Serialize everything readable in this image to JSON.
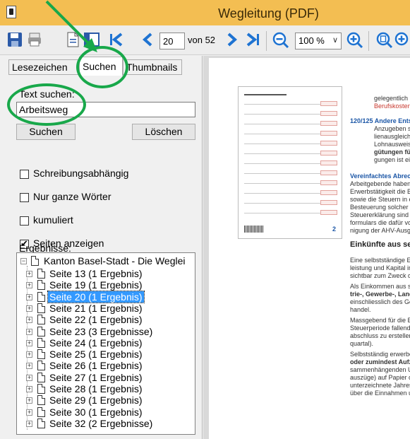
{
  "window": {
    "title": "Wegleitung (PDF)"
  },
  "toolbar": {
    "page_value": "20",
    "page_total_label": "von 52",
    "zoom_value": "100 %",
    "icons": [
      "save-icon",
      "print-icon",
      "document-icon",
      "sidebar-icon",
      "first-page-icon",
      "previous-page-icon",
      "next-page-icon",
      "last-page-icon",
      "zoom-out-icon",
      "zoom-in-icon",
      "zoom-page-icon",
      "zoom-width-icon"
    ]
  },
  "tabs": [
    {
      "label": "Lesezeichen"
    },
    {
      "label": "Suchen"
    },
    {
      "label": "Thumbnails"
    }
  ],
  "search": {
    "label": "Text suchen:",
    "value": "Arbeitsweg",
    "search_button": "Suchen",
    "clear_button": "Löschen"
  },
  "options": [
    {
      "label": "Schreibungsabhängig",
      "checked": false
    },
    {
      "label": "Nur ganze Wörter",
      "checked": false
    },
    {
      "label": "kumuliert",
      "checked": false
    },
    {
      "label": "Seiten anzeigen",
      "checked": true
    }
  ],
  "results": {
    "label": "Ergebnisse:",
    "root": "Kanton Basel-Stadt - Die Weglei",
    "items": [
      {
        "label": "Seite 13 (1 Ergebnis)",
        "selected": false
      },
      {
        "label": "Seite 19 (1 Ergebnis)",
        "selected": false
      },
      {
        "label": "Seite 20 (1 Ergebnis)",
        "selected": true
      },
      {
        "label": "Seite 21 (1 Ergebnis)",
        "selected": false
      },
      {
        "label": "Seite 22 (1 Ergebnis)",
        "selected": false
      },
      {
        "label": "Seite 23 (3 Ergebnisse)",
        "selected": false
      },
      {
        "label": "Seite 24 (1 Ergebnis)",
        "selected": false
      },
      {
        "label": "Seite 25 (1 Ergebnis)",
        "selected": false
      },
      {
        "label": "Seite 26 (1 Ergebnis)",
        "selected": false
      },
      {
        "label": "Seite 27 (1 Ergebnis)",
        "selected": false
      },
      {
        "label": "Seite 28 (1 Ergebnis)",
        "selected": false
      },
      {
        "label": "Seite 29 (1 Ergebnis)",
        "selected": false
      },
      {
        "label": "Seite 30 (1 Ergebnis)",
        "selected": false
      },
      {
        "label": "Seite 32 (2 Ergebnisse)",
        "selected": false
      }
    ]
  },
  "document": {
    "lines": [
      {
        "text": "gelegentlich",
        "style": ""
      },
      {
        "text": "Berufskosten",
        "style": "red"
      },
      {
        "text": "120/125  Andere Entsc",
        "style": "blue"
      },
      {
        "text": "Anzugeben si",
        "style": ""
      },
      {
        "text": "lienausgleichs",
        "style": ""
      },
      {
        "text": "Lohnausweis",
        "style": ""
      },
      {
        "text": "gütungen für",
        "style": "bold"
      },
      {
        "text": "gungen ist ei",
        "style": ""
      },
      {
        "text": "Vereinfachtes Abrechn",
        "style": "blue"
      },
      {
        "text": "Arbeitgebende haben s",
        "style": ""
      },
      {
        "text": "Erwerbstätigkeit die Beh",
        "style": ""
      },
      {
        "text": "sowie die Steuern in ein",
        "style": ""
      },
      {
        "text": "Besteuerung solcher kle",
        "style": ""
      },
      {
        "text": "Steuererklärung sind die",
        "style": ""
      },
      {
        "text": "formulars die dafür vorg",
        "style": ""
      },
      {
        "text": "nigung der AHV-Ausglei",
        "style": ""
      },
      {
        "text": "Einkünfte aus selb",
        "style": "h"
      },
      {
        "text": "Eine selbstständige Erw",
        "style": ""
      },
      {
        "text": "leistung und Kapital in",
        "style": ""
      },
      {
        "text": "sichtbar zum Zweck der",
        "style": ""
      },
      {
        "text": "Als Einkommen aus selb",
        "style": ""
      },
      {
        "text": "trie-, Gewerbe-, Land",
        "style": "bold"
      },
      {
        "text": "einschliesslich des Gewi",
        "style": ""
      },
      {
        "text": "handel.",
        "style": ""
      },
      {
        "text": "Massgebend für die Erm",
        "style": ""
      },
      {
        "text": "Steuerperiode fallenden",
        "style": ""
      },
      {
        "text": "abschluss zu erstellen (a",
        "style": ""
      },
      {
        "text": "quartal).",
        "style": ""
      },
      {
        "text": "Selbstständig erwerben",
        "style": ""
      },
      {
        "text": "oder zumindest Aufzeic",
        "style": "bold"
      },
      {
        "text": "sammenhängenden Urk",
        "style": ""
      },
      {
        "text": "auszüge) auf Papier ode",
        "style": ""
      },
      {
        "text": "unterzeichnete Jahrese",
        "style": ""
      },
      {
        "text": "über die Einnahmen un",
        "style": ""
      }
    ],
    "thumb_page_number": "2"
  },
  "colors": {
    "titlebar": "#f3be52",
    "selection": "#3399ff",
    "annotation": "#18a84a",
    "doc_red": "#c8372d",
    "doc_blue": "#1b56a6"
  }
}
